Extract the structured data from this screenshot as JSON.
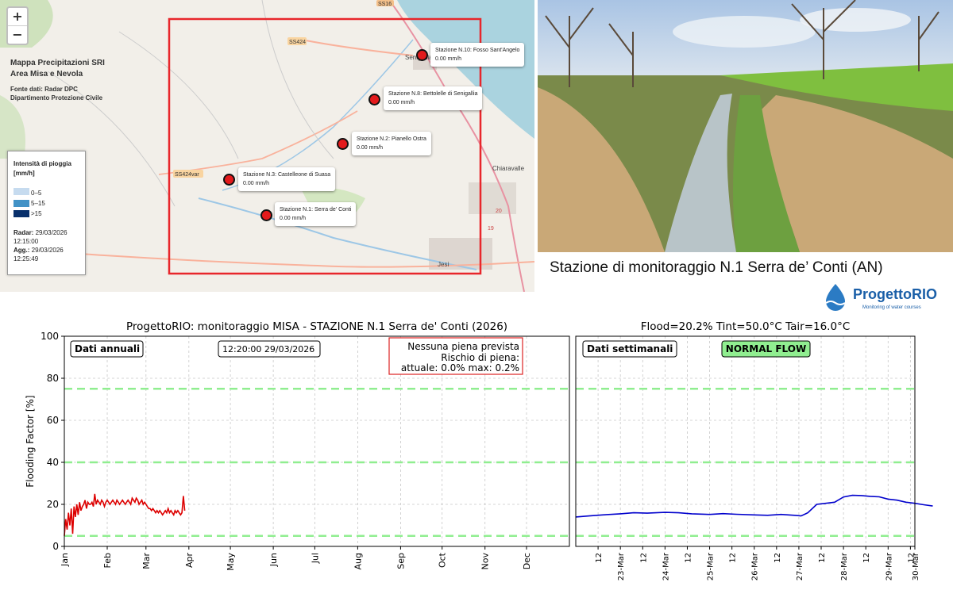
{
  "map": {
    "zoom_in": "+",
    "zoom_out": "−",
    "title_line1": "Mappa Precipitazioni SRI",
    "title_line2": "Area Misa e Nevola",
    "source_line1": "Fonte dati: Radar DPC",
    "source_line2": "Dipartimento Protezione Civile",
    "road_labels": [
      "SS16",
      "SS424",
      "SS424var"
    ],
    "place_labels": [
      "Senigallia",
      "Chiaravalle",
      "Jesi"
    ],
    "road_numbers": [
      "20",
      "19"
    ],
    "legend": {
      "title_line1": "Intensità di pioggia",
      "title_line2": "[mm/h]",
      "items": [
        {
          "label": "0–5",
          "color": "#c6dbef"
        },
        {
          "label": "5–15",
          "color": "#4292c6"
        },
        {
          "label": ">15",
          "color": "#08306b"
        }
      ],
      "radar_label": "Radar:",
      "radar_date": "29/03/2026",
      "radar_time": "12:15:00",
      "agg_label": "Agg.:",
      "agg_date": "29/03/2026",
      "agg_time": "12:25:49"
    },
    "stations": [
      {
        "name": "Stazione N.10: Fosso Sant'Angelo",
        "value": "0.00 mm/h"
      },
      {
        "name": "Stazione N.8: Bettolelle di Senigallia",
        "value": "0.00 mm/h"
      },
      {
        "name": "Stazione N.2: Pianello Ostra",
        "value": "0.00 mm/h"
      },
      {
        "name": "Stazione N.3: Castelleone di Suasa",
        "value": "0.00 mm/h"
      },
      {
        "name": "Stazione N.1: Serra de' Conti",
        "value": "0.00 mm/h"
      }
    ],
    "area_color": "#e8262b",
    "station_color": "#e31a1c"
  },
  "photo_caption": "Stazione di monitoraggio N.1 Serra de’ Conti (AN)",
  "logo": {
    "name": "ProgettoRIO",
    "tagline": "Monitoring of water courses"
  },
  "chart_data": [
    {
      "type": "line",
      "title": "ProgettoRIO: monitoraggio MISA - STAZIONE N.1 Serra de' Conti (2026)",
      "ylabel": "Flooding Factor [%]",
      "ylim": [
        0,
        100
      ],
      "yticks": [
        "0",
        "20",
        "40",
        "60",
        "80",
        "100"
      ],
      "xlim": [
        0,
        365
      ],
      "xticks": [
        {
          "x": 0,
          "label": "Jan"
        },
        {
          "x": 31,
          "label": "Feb"
        },
        {
          "x": 59,
          "label": "Mar"
        },
        {
          "x": 90,
          "label": "Apr"
        },
        {
          "x": 120,
          "label": "May"
        },
        {
          "x": 151,
          "label": "Jun"
        },
        {
          "x": 181,
          "label": "Jul"
        },
        {
          "x": 212,
          "label": "Aug"
        },
        {
          "x": 243,
          "label": "Sep"
        },
        {
          "x": 273,
          "label": "Oct"
        },
        {
          "x": 304,
          "label": "Nov"
        },
        {
          "x": 334,
          "label": "Dec"
        }
      ],
      "box_label": "Dati annuali",
      "timestamp": "12:20:00   29/03/2026",
      "forecast_line1": "Nessuna piena prevista",
      "forecast_line2": "Rischio di piena:",
      "forecast_line3": "attuale: 0.0%   max: 0.2%",
      "thresholds": [
        5,
        40,
        75
      ],
      "threshold_color": "#90ee90",
      "grid": true,
      "series": [
        {
          "color": "#dd0000",
          "x": [
            0,
            1,
            2,
            3,
            4,
            5,
            6,
            7,
            8,
            9,
            10,
            11,
            12,
            13,
            14,
            15,
            16,
            17,
            18,
            19,
            20,
            21,
            22,
            23,
            24,
            25,
            26,
            27,
            28,
            29,
            30,
            31,
            32,
            33,
            34,
            35,
            36,
            37,
            38,
            39,
            40,
            41,
            42,
            43,
            44,
            45,
            46,
            47,
            48,
            49,
            50,
            51,
            52,
            53,
            54,
            55,
            56,
            57,
            58,
            59,
            60,
            61,
            62,
            63,
            64,
            65,
            66,
            67,
            68,
            69,
            70,
            71,
            72,
            73,
            74,
            75,
            76,
            77,
            78,
            79,
            80,
            81,
            82,
            83,
            84,
            85,
            86,
            87
          ],
          "y": [
            5,
            13,
            8,
            16,
            10,
            18,
            6,
            19,
            14,
            20,
            15,
            21,
            17,
            19,
            20,
            22,
            18,
            21,
            20,
            20,
            21,
            19,
            25,
            20,
            22,
            21,
            20,
            22,
            21,
            19,
            21,
            22,
            21,
            20,
            21,
            22,
            21,
            20,
            22,
            21,
            20,
            21,
            22,
            21,
            20,
            21,
            22,
            21,
            20,
            23,
            22,
            21,
            23,
            22,
            20,
            21,
            22,
            20,
            21,
            20,
            19,
            18,
            18,
            17,
            18,
            17,
            16,
            17,
            16,
            17,
            16,
            15,
            16,
            17,
            16,
            18,
            16,
            17,
            16,
            15,
            17,
            16,
            17,
            16,
            15,
            16,
            24,
            17
          ]
        }
      ]
    },
    {
      "type": "line",
      "title": "Flood=20.2%    Tint=50.0°C    Tair=16.0°C",
      "box_label": "Dati settimanali",
      "status": "NORMAL FLOW",
      "status_color": "#90ee90",
      "ylim": [
        0,
        100
      ],
      "xlim": [
        0,
        7.6
      ],
      "xticks": [
        {
          "x": 0.5,
          "label": "12"
        },
        {
          "x": 1.0,
          "label": "23-Mar"
        },
        {
          "x": 1.5,
          "label": "12"
        },
        {
          "x": 2.0,
          "label": "24-Mar"
        },
        {
          "x": 2.5,
          "label": "12"
        },
        {
          "x": 3.0,
          "label": "25-Mar"
        },
        {
          "x": 3.5,
          "label": "12"
        },
        {
          "x": 4.0,
          "label": "26-Mar"
        },
        {
          "x": 4.5,
          "label": "12"
        },
        {
          "x": 5.0,
          "label": "27-Mar"
        },
        {
          "x": 5.5,
          "label": "12"
        },
        {
          "x": 6.0,
          "label": "28-Mar"
        },
        {
          "x": 6.5,
          "label": "12"
        },
        {
          "x": 7.0,
          "label": "29-Mar"
        },
        {
          "x": 7.5,
          "label": "12"
        },
        {
          "x": 8.0,
          "label": "30-Mar"
        }
      ],
      "thresholds": [
        5,
        40,
        75
      ],
      "grid": true,
      "series": [
        {
          "color": "#0000cc",
          "x": [
            0,
            0.3,
            0.6,
            1.0,
            1.3,
            1.6,
            2.0,
            2.3,
            2.6,
            3.0,
            3.3,
            3.6,
            4.0,
            4.3,
            4.6,
            4.9,
            5.05,
            5.2,
            5.4,
            5.6,
            5.8,
            6.0,
            6.2,
            6.4,
            6.6,
            6.8,
            7.0,
            7.2,
            7.4,
            7.6,
            7.8,
            8.0
          ],
          "y": [
            14,
            14.5,
            15,
            15.5,
            16,
            15.8,
            16.2,
            16,
            15.5,
            15.2,
            15.6,
            15.3,
            15,
            14.8,
            15.2,
            14.8,
            14.5,
            16,
            20,
            20.5,
            21,
            23.5,
            24.3,
            24.2,
            23.8,
            23.6,
            22.5,
            22,
            21,
            20.5,
            19.8,
            19.2
          ]
        }
      ]
    }
  ]
}
